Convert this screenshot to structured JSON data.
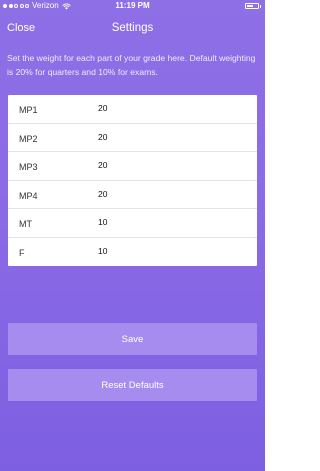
{
  "status_bar": {
    "carrier": "Verizon",
    "time": "11:19 PM",
    "signal_bars_filled": 2,
    "signal_bars_total": 5,
    "battery_level": 0.6
  },
  "nav": {
    "close_label": "Close",
    "title": "Settings"
  },
  "description": "Set the weight for each part of your grade here. Default weighting is 20% for quarters and 10% for exams.",
  "grades": [
    {
      "label": "MP1",
      "value": "20"
    },
    {
      "label": "MP2",
      "value": "20"
    },
    {
      "label": "MP3",
      "value": "20"
    },
    {
      "label": "MP4",
      "value": "20"
    },
    {
      "label": "MT",
      "value": "10"
    },
    {
      "label": "F",
      "value": "10"
    }
  ],
  "buttons": {
    "save": "Save",
    "reset": "Reset Defaults"
  },
  "colors": {
    "background_top": "#8e6fe6",
    "background_bottom": "#7d5fe1",
    "button": "#a78cf0"
  }
}
